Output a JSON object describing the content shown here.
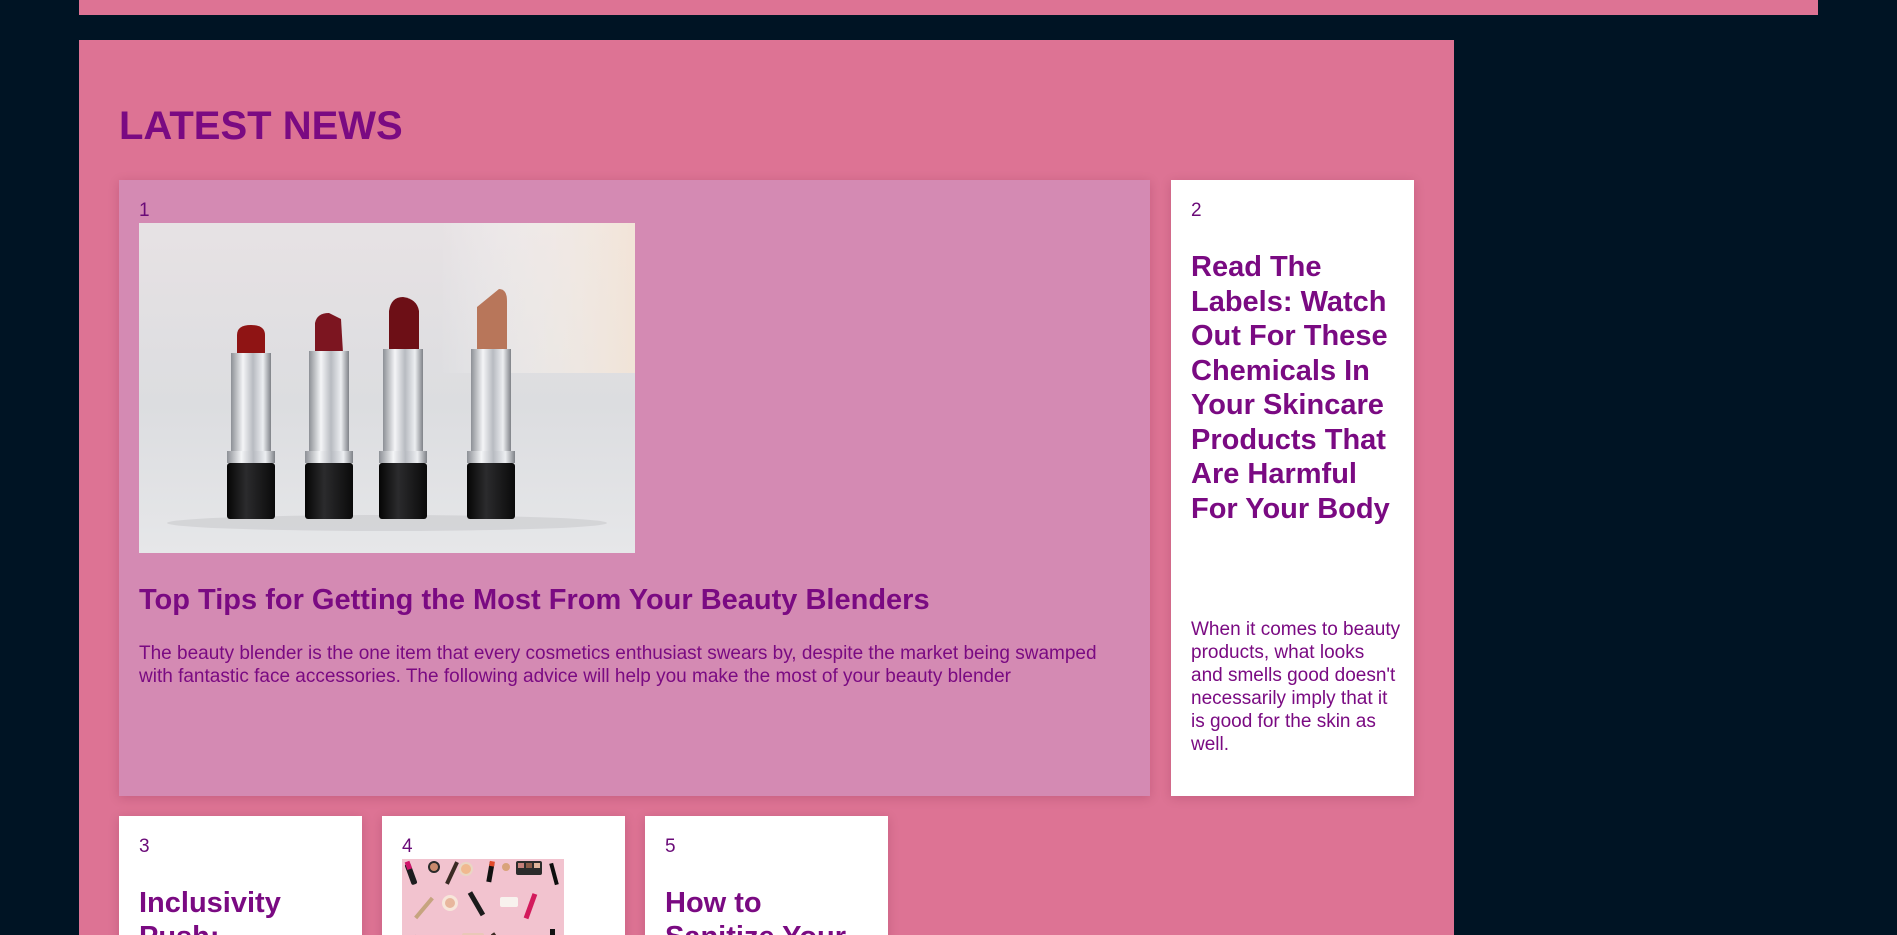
{
  "colors": {
    "page_background": "#001424",
    "panel_background": "#dd7394",
    "featured_card_background": "#d48ab3",
    "card_background": "#ffffff",
    "text_purple": "#7a0a82"
  },
  "section": {
    "heading": "LATEST NEWS"
  },
  "articles": [
    {
      "number": "1",
      "title": "Top Tips for Getting the Most From Your Beauty Blenders",
      "excerpt": "The beauty blender is the one item that every cosmetics enthusiast swears by, despite the market being swamped with fantastic face accessories. The following advice will help you make the most of your beauty blender",
      "image": "lipsticks-photo"
    },
    {
      "number": "2",
      "title": "Read The Labels: Watch Out For These Chemicals In Your Skincare Products That Are Harmful For Your Body",
      "excerpt": "When it comes to beauty products, what looks and smells good doesn't necessarily imply that it is good for the skin as well."
    },
    {
      "number": "3",
      "title": "Inclusivity Push:"
    },
    {
      "number": "4",
      "image": "makeup-flatlay-photo"
    },
    {
      "number": "5",
      "title": "How to Sanitize Your"
    }
  ]
}
